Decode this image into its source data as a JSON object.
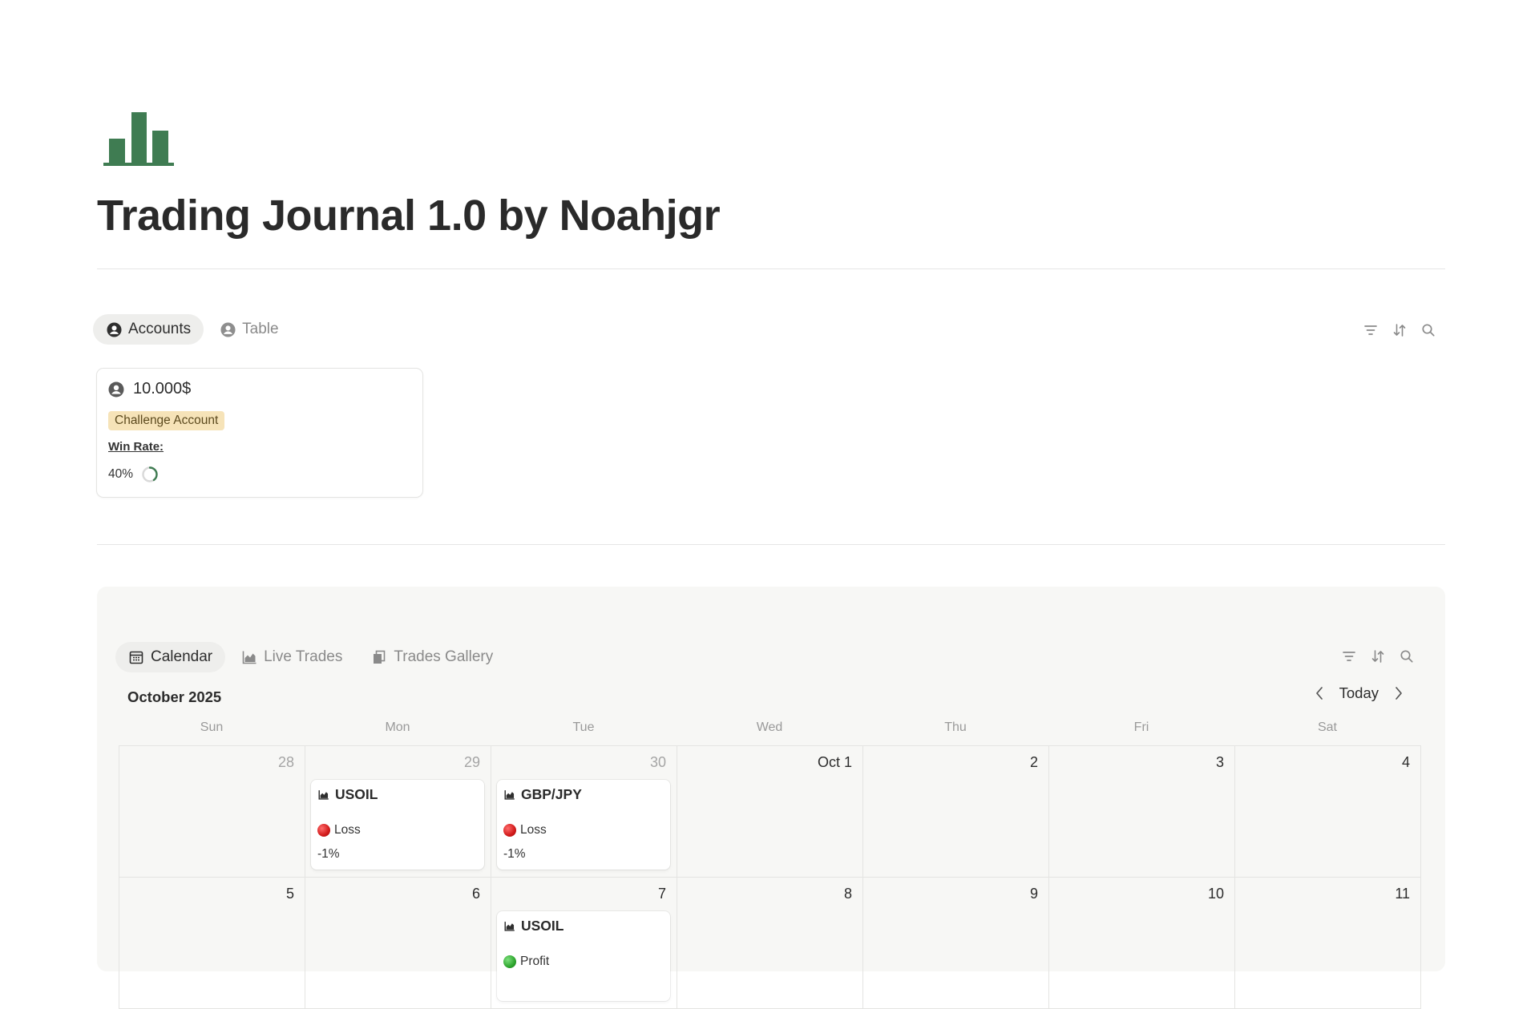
{
  "page": {
    "title": "Trading Journal 1.0 by Noahjgr",
    "icon": "bar-chart-icon",
    "accent_color": "#3f7c52"
  },
  "accounts_view": {
    "tabs": [
      {
        "label": "Accounts",
        "icon": "person-circle-icon",
        "active": true
      },
      {
        "label": "Table",
        "icon": "person-circle-icon",
        "active": false
      }
    ],
    "tools": [
      "filter-icon",
      "sort-icon",
      "search-icon"
    ],
    "card": {
      "name": "10.000$",
      "tag": "Challenge Account",
      "tag_color": "#f6e3b8",
      "win_rate_label": "Win Rate:",
      "win_rate_value": "40%",
      "win_rate_fraction": 0.4
    }
  },
  "calendar_view": {
    "tabs": [
      {
        "label": "Calendar",
        "icon": "calendar-icon",
        "active": true
      },
      {
        "label": "Live Trades",
        "icon": "line-chart-icon",
        "active": false
      },
      {
        "label": "Trades Gallery",
        "icon": "gallery-icon",
        "active": false
      }
    ],
    "tools": [
      "filter-icon",
      "sort-icon",
      "search-icon"
    ],
    "month_label": "October 2025",
    "today_label": "Today",
    "weekdays": [
      "Sun",
      "Mon",
      "Tue",
      "Wed",
      "Thu",
      "Fri",
      "Sat"
    ],
    "days": [
      {
        "label": "28",
        "muted": true
      },
      {
        "label": "29",
        "muted": true,
        "trade": {
          "symbol": "USOIL",
          "status": "Loss",
          "status_color": "red",
          "pct": "-1%"
        }
      },
      {
        "label": "30",
        "muted": true,
        "trade": {
          "symbol": "GBP/JPY",
          "status": "Loss",
          "status_color": "red",
          "pct": "-1%"
        }
      },
      {
        "label": "Oct 1",
        "muted": false
      },
      {
        "label": "2",
        "muted": false
      },
      {
        "label": "3",
        "muted": false
      },
      {
        "label": "4",
        "muted": false
      },
      {
        "label": "5",
        "muted": false
      },
      {
        "label": "6",
        "muted": false
      },
      {
        "label": "7",
        "muted": false,
        "trade": {
          "symbol": "USOIL",
          "status": "Profit",
          "status_color": "green",
          "pct": ""
        }
      },
      {
        "label": "8",
        "muted": false
      },
      {
        "label": "9",
        "muted": false
      },
      {
        "label": "10",
        "muted": false
      },
      {
        "label": "11",
        "muted": false
      }
    ]
  }
}
